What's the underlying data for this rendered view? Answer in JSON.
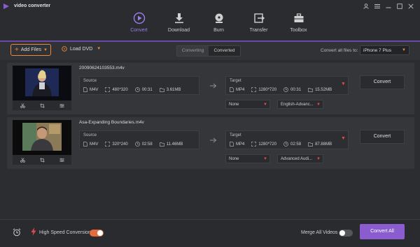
{
  "app": {
    "title": "video converter"
  },
  "nav": {
    "tabs": [
      {
        "label": "Convert",
        "icon": "convert-icon",
        "active": true
      },
      {
        "label": "Download",
        "icon": "download-icon",
        "active": false
      },
      {
        "label": "Burn",
        "icon": "burn-icon",
        "active": false
      },
      {
        "label": "Transfer",
        "icon": "transfer-icon",
        "active": false
      },
      {
        "label": "Toolbox",
        "icon": "toolbox-icon",
        "active": false
      }
    ]
  },
  "toolbar": {
    "add_files": "Add Files",
    "load_dvd": "Load DVD",
    "segments": [
      "Converting",
      "Converted"
    ],
    "convert_all_label": "Convert all files to:",
    "preset": "iPhone 7 Plus"
  },
  "items": [
    {
      "filename": "20090624103553.m4v",
      "source_label": "Source",
      "source": {
        "format": "M4V",
        "resolution": "480*320",
        "duration": "00:31",
        "size": "3.61MB"
      },
      "target_label": "Target",
      "target": {
        "format": "MP4",
        "resolution": "1280*720",
        "duration": "00:31",
        "size": "15.52MB"
      },
      "subtitle": "None",
      "audio": "English-Advanc...",
      "convert": "Convert"
    },
    {
      "filename": "Asa-Expanding Boundaries.m4v",
      "source_label": "Source",
      "source": {
        "format": "M4V",
        "resolution": "320*240",
        "duration": "02:58",
        "size": "11.46MB"
      },
      "target_label": "Target",
      "target": {
        "format": "MP4",
        "resolution": "1280*720",
        "duration": "02:58",
        "size": "87.88MB"
      },
      "subtitle": "None",
      "audio": "Advanced Audi...",
      "convert": "Convert"
    }
  ],
  "footer": {
    "high_speed_label": "High Speed Conversion",
    "high_speed_on": true,
    "merge_label": "Merge All Videos",
    "merge_on": false,
    "convert_all": "Convert All"
  },
  "colors": {
    "accent": "#8a5ccf",
    "orange": "#e98b3b",
    "red": "#e24a4a"
  }
}
